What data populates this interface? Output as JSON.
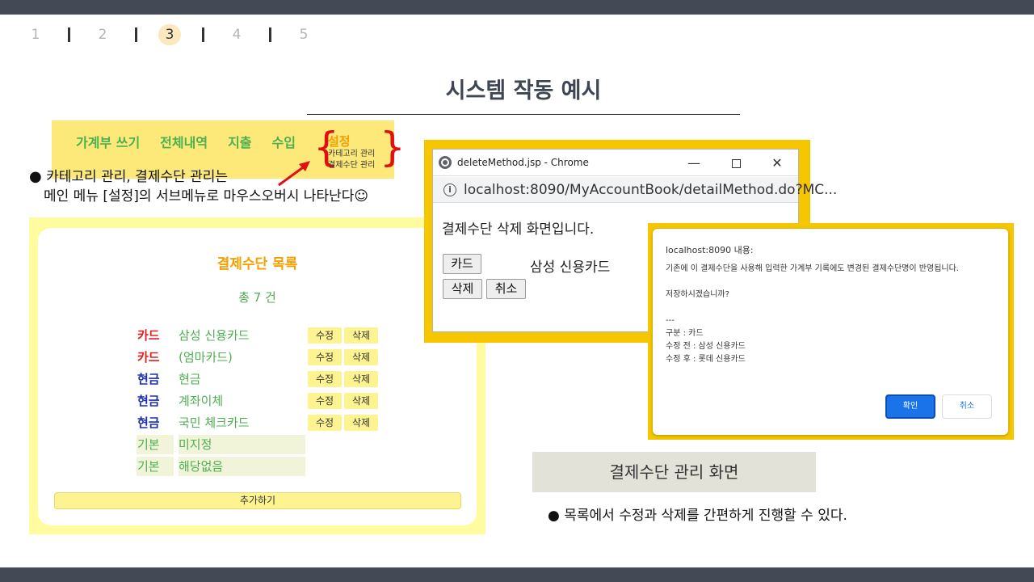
{
  "pager": {
    "pages": [
      "1",
      "2",
      "3",
      "4",
      "5"
    ],
    "active_index": 2
  },
  "slide": {
    "title": "시스템 작동 예시"
  },
  "menu": {
    "items": [
      "가계부 쓰기",
      "전체내역",
      "지출",
      "수입"
    ],
    "settings_label": "설정",
    "submenu": [
      "카테고리 관리",
      "결제수단 관리"
    ]
  },
  "note_submenu": {
    "line1": "카테고리 관리, 결제수단 관리는",
    "line2": "메인 메뉴 [설정]의 서브메뉴로 마우스오버시 나타난다☺"
  },
  "method_list": {
    "title": "결제수단 목록",
    "count": "총 7 건",
    "rows": [
      {
        "category": "카드",
        "name": "삼성 신용카드",
        "editable": true
      },
      {
        "category": "카드",
        "name": "(엄마카드)",
        "editable": true
      },
      {
        "category": "현금",
        "name": "현금",
        "editable": true
      },
      {
        "category": "현금",
        "name": "계좌이체",
        "editable": true
      },
      {
        "category": "현금",
        "name": "국민 체크카드",
        "editable": true
      },
      {
        "category": "기본",
        "name": "미지정",
        "editable": false
      },
      {
        "category": "기본",
        "name": "해당없음",
        "editable": false
      }
    ],
    "edit_label": "수정",
    "delete_label": "삭제",
    "add_label": "추가하기"
  },
  "colors": {
    "card": "#e02020",
    "cash": "#1c2fae",
    "basic": "#4caf50",
    "accent": "#f5a000",
    "frame": "#f6c700"
  },
  "chrome_window": {
    "title": "deleteMethod.jsp - Chrome",
    "min_glyph": "—",
    "close_glyph": "✕",
    "info_glyph": "i",
    "url": "localhost:8090/MyAccountBook/detailMethod.do?MC...",
    "message": "결제수단 삭제 화면입니다.",
    "category_button": "카드",
    "method_name": "삼성 신용카드",
    "delete_button": "삭제",
    "cancel_button": "취소"
  },
  "confirm_dialog": {
    "header": "localhost:8090 내용:",
    "lines": [
      "기존에 이 결제수단을 사용해 입력한 가계부 기록에도 변경된 결제수단명이 반영됩니다.",
      "",
      "저장하시겠습니까?",
      "",
      "---",
      "구분 : 카드",
      "수정 전 : 삼성 신용카드",
      "수정 후 : 롯데 신용카드"
    ],
    "ok_label": "확인",
    "cancel_label": "취소"
  },
  "caption": "결제수단 관리 화면",
  "note_bottom": "목록에서 수정과 삭제를 간편하게 진행할 수 있다."
}
